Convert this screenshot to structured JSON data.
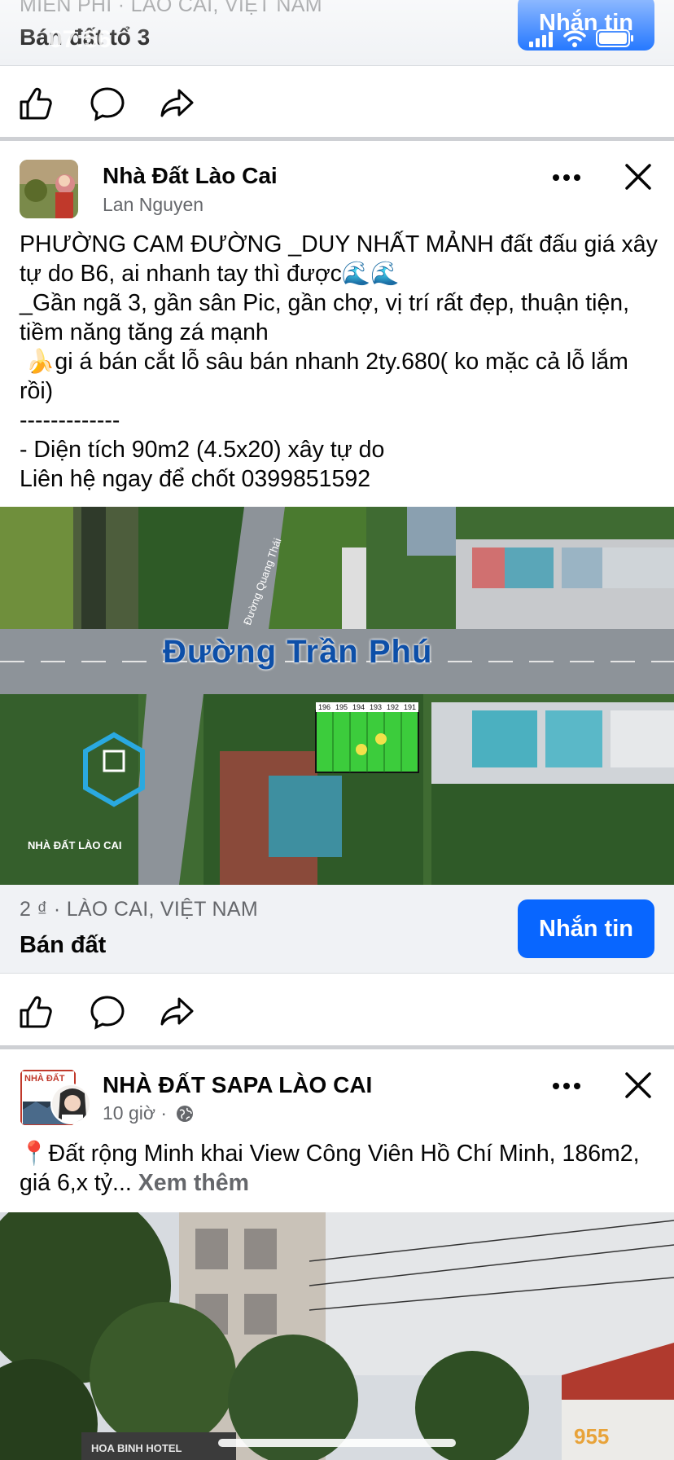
{
  "status_bar": {
    "time": "07:56"
  },
  "prev_post": {
    "location": "MIỄN PHÍ · LÀO CAI, VIỆT NAM",
    "title": "Bán đất tổ 3",
    "message_button": "Nhắn tin"
  },
  "post1": {
    "page_name": "Nhà Đất Lào Cai",
    "author": "Lan Nguyen",
    "text": "PHƯỜNG CAM ĐƯỜNG _DUY NHẤT MẢNH đất đấu giá xây tự do B6, ai nhanh tay thì được🌊🌊\n_Gần ngã 3, gần sân Pic, gần chợ, vị trí rất đẹp, thuận tiện, tiềm năng tăng zá mạnh\n 🍌gi á bán cắt lỗ sâu bán nhanh 2ty.680( ko mặc cả lỗ lắm rồi)\n-------------\n- Diện tích 90m2 (4.5x20) xây tự do\nLiên hệ ngay để chốt 0399851592",
    "photo": {
      "road_label": "Đường Trần Phú",
      "side_road_label": "Đường Quang Thái",
      "logo_text": "NHÀ ĐẤT LÀO CAI",
      "lot_numbers": [
        "196",
        "195",
        "194",
        "193",
        "192",
        "191"
      ]
    },
    "listing": {
      "price_location": "2 ₫ · LÀO CAI, VIỆT NAM",
      "title": "Bán đất",
      "message_button": "Nhắn tin"
    }
  },
  "post2": {
    "page_name": "NHÀ ĐẤT SAPA LÀO CAI",
    "avatar_text": "NHÀ ĐẤT",
    "time": "10 giờ ·",
    "text": "📍Đất rộng Minh khai View Công Viên Hồ Chí Minh, 186m2, giá 6,x tỷ... ",
    "see_more": "Xem thêm",
    "photo": {
      "sign_text": "HOA BINH HOTEL",
      "badge_text": "955"
    }
  },
  "icons": [
    "like-icon",
    "comment-icon",
    "share-icon",
    "more-icon",
    "close-icon",
    "globe-icon",
    "signal-icon",
    "wifi-icon",
    "battery-icon"
  ],
  "colors": {
    "brand_blue": "#0866ff",
    "secondary_text": "#65676b",
    "bar_bg": "#f0f2f5"
  }
}
